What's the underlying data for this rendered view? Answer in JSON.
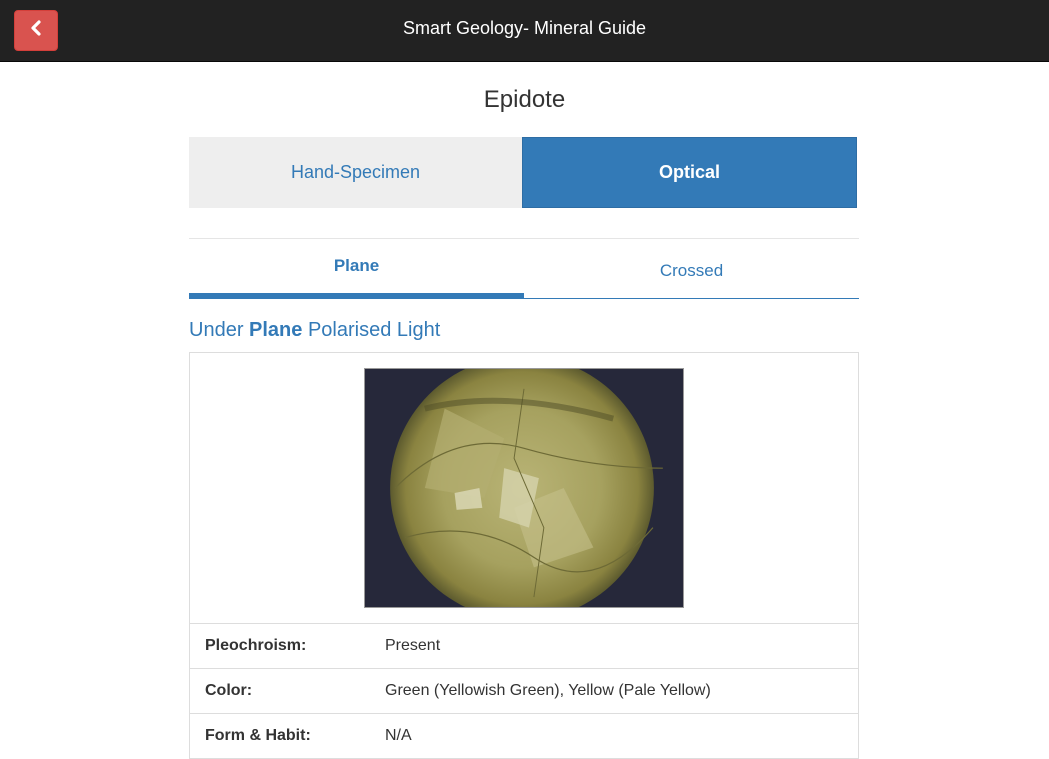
{
  "header": {
    "title": "Smart Geology- Mineral Guide",
    "back_icon": "chevron-left-icon",
    "back_color": "#d9534f",
    "bar_color": "#222222"
  },
  "mineral": {
    "name": "Epidote"
  },
  "mode_tabs": [
    {
      "label": "Hand-Specimen",
      "active": false
    },
    {
      "label": "Optical",
      "active": true
    }
  ],
  "light_tabs": [
    {
      "label": "Plane",
      "active": true
    },
    {
      "label": "Crossed",
      "active": false
    }
  ],
  "section": {
    "prefix": "Under ",
    "emphasis": "Plane",
    "suffix": " Polarised Light"
  },
  "properties": [
    {
      "label": "Pleochroism:",
      "value": "Present"
    },
    {
      "label": "Color:",
      "value": "Green (Yellowish Green), Yellow (Pale Yellow)"
    },
    {
      "label": "Form & Habit:",
      "value": "N/A"
    }
  ],
  "colors": {
    "accent": "#337ab7",
    "tab_inactive_bg": "#eeeeee"
  }
}
